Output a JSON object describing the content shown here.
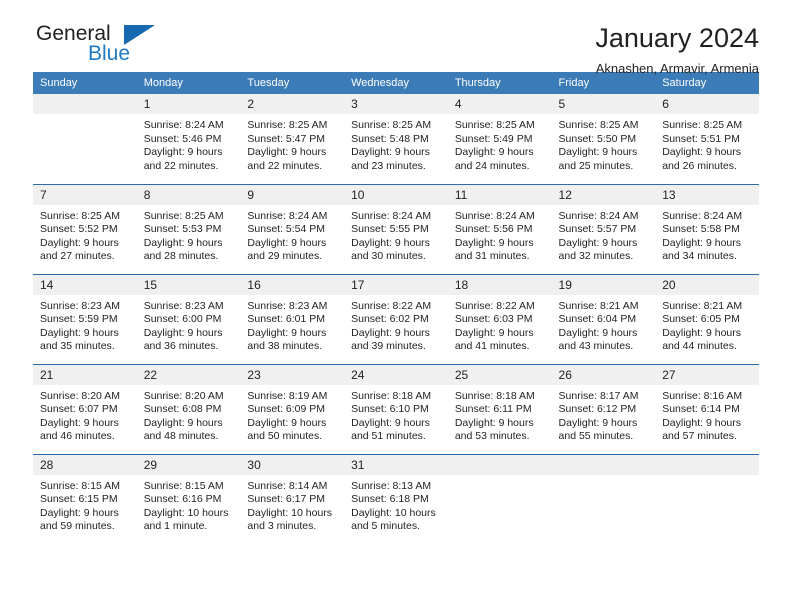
{
  "brand": {
    "line1": "General",
    "line2": "Blue",
    "accent_color": "#1668b0",
    "text_color": "#231f20"
  },
  "header": {
    "title": "January 2024",
    "subtitle": "Aknashen, Armavir, Armenia"
  },
  "calendar": {
    "header_background": "#3b7cb8",
    "daynum_background": "#f0f0f0",
    "weekday_headers": [
      "Sunday",
      "Monday",
      "Tuesday",
      "Wednesday",
      "Thursday",
      "Friday",
      "Saturday"
    ],
    "weeks": [
      [
        {
          "day": "",
          "sunrise": "",
          "sunset": "",
          "daylight1": "",
          "daylight2": ""
        },
        {
          "day": "1",
          "sunrise": "Sunrise: 8:24 AM",
          "sunset": "Sunset: 5:46 PM",
          "daylight1": "Daylight: 9 hours",
          "daylight2": "and 22 minutes."
        },
        {
          "day": "2",
          "sunrise": "Sunrise: 8:25 AM",
          "sunset": "Sunset: 5:47 PM",
          "daylight1": "Daylight: 9 hours",
          "daylight2": "and 22 minutes."
        },
        {
          "day": "3",
          "sunrise": "Sunrise: 8:25 AM",
          "sunset": "Sunset: 5:48 PM",
          "daylight1": "Daylight: 9 hours",
          "daylight2": "and 23 minutes."
        },
        {
          "day": "4",
          "sunrise": "Sunrise: 8:25 AM",
          "sunset": "Sunset: 5:49 PM",
          "daylight1": "Daylight: 9 hours",
          "daylight2": "and 24 minutes."
        },
        {
          "day": "5",
          "sunrise": "Sunrise: 8:25 AM",
          "sunset": "Sunset: 5:50 PM",
          "daylight1": "Daylight: 9 hours",
          "daylight2": "and 25 minutes."
        },
        {
          "day": "6",
          "sunrise": "Sunrise: 8:25 AM",
          "sunset": "Sunset: 5:51 PM",
          "daylight1": "Daylight: 9 hours",
          "daylight2": "and 26 minutes."
        }
      ],
      [
        {
          "day": "7",
          "sunrise": "Sunrise: 8:25 AM",
          "sunset": "Sunset: 5:52 PM",
          "daylight1": "Daylight: 9 hours",
          "daylight2": "and 27 minutes."
        },
        {
          "day": "8",
          "sunrise": "Sunrise: 8:25 AM",
          "sunset": "Sunset: 5:53 PM",
          "daylight1": "Daylight: 9 hours",
          "daylight2": "and 28 minutes."
        },
        {
          "day": "9",
          "sunrise": "Sunrise: 8:24 AM",
          "sunset": "Sunset: 5:54 PM",
          "daylight1": "Daylight: 9 hours",
          "daylight2": "and 29 minutes."
        },
        {
          "day": "10",
          "sunrise": "Sunrise: 8:24 AM",
          "sunset": "Sunset: 5:55 PM",
          "daylight1": "Daylight: 9 hours",
          "daylight2": "and 30 minutes."
        },
        {
          "day": "11",
          "sunrise": "Sunrise: 8:24 AM",
          "sunset": "Sunset: 5:56 PM",
          "daylight1": "Daylight: 9 hours",
          "daylight2": "and 31 minutes."
        },
        {
          "day": "12",
          "sunrise": "Sunrise: 8:24 AM",
          "sunset": "Sunset: 5:57 PM",
          "daylight1": "Daylight: 9 hours",
          "daylight2": "and 32 minutes."
        },
        {
          "day": "13",
          "sunrise": "Sunrise: 8:24 AM",
          "sunset": "Sunset: 5:58 PM",
          "daylight1": "Daylight: 9 hours",
          "daylight2": "and 34 minutes."
        }
      ],
      [
        {
          "day": "14",
          "sunrise": "Sunrise: 8:23 AM",
          "sunset": "Sunset: 5:59 PM",
          "daylight1": "Daylight: 9 hours",
          "daylight2": "and 35 minutes."
        },
        {
          "day": "15",
          "sunrise": "Sunrise: 8:23 AM",
          "sunset": "Sunset: 6:00 PM",
          "daylight1": "Daylight: 9 hours",
          "daylight2": "and 36 minutes."
        },
        {
          "day": "16",
          "sunrise": "Sunrise: 8:23 AM",
          "sunset": "Sunset: 6:01 PM",
          "daylight1": "Daylight: 9 hours",
          "daylight2": "and 38 minutes."
        },
        {
          "day": "17",
          "sunrise": "Sunrise: 8:22 AM",
          "sunset": "Sunset: 6:02 PM",
          "daylight1": "Daylight: 9 hours",
          "daylight2": "and 39 minutes."
        },
        {
          "day": "18",
          "sunrise": "Sunrise: 8:22 AM",
          "sunset": "Sunset: 6:03 PM",
          "daylight1": "Daylight: 9 hours",
          "daylight2": "and 41 minutes."
        },
        {
          "day": "19",
          "sunrise": "Sunrise: 8:21 AM",
          "sunset": "Sunset: 6:04 PM",
          "daylight1": "Daylight: 9 hours",
          "daylight2": "and 43 minutes."
        },
        {
          "day": "20",
          "sunrise": "Sunrise: 8:21 AM",
          "sunset": "Sunset: 6:05 PM",
          "daylight1": "Daylight: 9 hours",
          "daylight2": "and 44 minutes."
        }
      ],
      [
        {
          "day": "21",
          "sunrise": "Sunrise: 8:20 AM",
          "sunset": "Sunset: 6:07 PM",
          "daylight1": "Daylight: 9 hours",
          "daylight2": "and 46 minutes."
        },
        {
          "day": "22",
          "sunrise": "Sunrise: 8:20 AM",
          "sunset": "Sunset: 6:08 PM",
          "daylight1": "Daylight: 9 hours",
          "daylight2": "and 48 minutes."
        },
        {
          "day": "23",
          "sunrise": "Sunrise: 8:19 AM",
          "sunset": "Sunset: 6:09 PM",
          "daylight1": "Daylight: 9 hours",
          "daylight2": "and 50 minutes."
        },
        {
          "day": "24",
          "sunrise": "Sunrise: 8:18 AM",
          "sunset": "Sunset: 6:10 PM",
          "daylight1": "Daylight: 9 hours",
          "daylight2": "and 51 minutes."
        },
        {
          "day": "25",
          "sunrise": "Sunrise: 8:18 AM",
          "sunset": "Sunset: 6:11 PM",
          "daylight1": "Daylight: 9 hours",
          "daylight2": "and 53 minutes."
        },
        {
          "day": "26",
          "sunrise": "Sunrise: 8:17 AM",
          "sunset": "Sunset: 6:12 PM",
          "daylight1": "Daylight: 9 hours",
          "daylight2": "and 55 minutes."
        },
        {
          "day": "27",
          "sunrise": "Sunrise: 8:16 AM",
          "sunset": "Sunset: 6:14 PM",
          "daylight1": "Daylight: 9 hours",
          "daylight2": "and 57 minutes."
        }
      ],
      [
        {
          "day": "28",
          "sunrise": "Sunrise: 8:15 AM",
          "sunset": "Sunset: 6:15 PM",
          "daylight1": "Daylight: 9 hours",
          "daylight2": "and 59 minutes."
        },
        {
          "day": "29",
          "sunrise": "Sunrise: 8:15 AM",
          "sunset": "Sunset: 6:16 PM",
          "daylight1": "Daylight: 10 hours",
          "daylight2": "and 1 minute."
        },
        {
          "day": "30",
          "sunrise": "Sunrise: 8:14 AM",
          "sunset": "Sunset: 6:17 PM",
          "daylight1": "Daylight: 10 hours",
          "daylight2": "and 3 minutes."
        },
        {
          "day": "31",
          "sunrise": "Sunrise: 8:13 AM",
          "sunset": "Sunset: 6:18 PM",
          "daylight1": "Daylight: 10 hours",
          "daylight2": "and 5 minutes."
        },
        {
          "day": "",
          "sunrise": "",
          "sunset": "",
          "daylight1": "",
          "daylight2": ""
        },
        {
          "day": "",
          "sunrise": "",
          "sunset": "",
          "daylight1": "",
          "daylight2": ""
        },
        {
          "day": "",
          "sunrise": "",
          "sunset": "",
          "daylight1": "",
          "daylight2": ""
        }
      ]
    ]
  }
}
